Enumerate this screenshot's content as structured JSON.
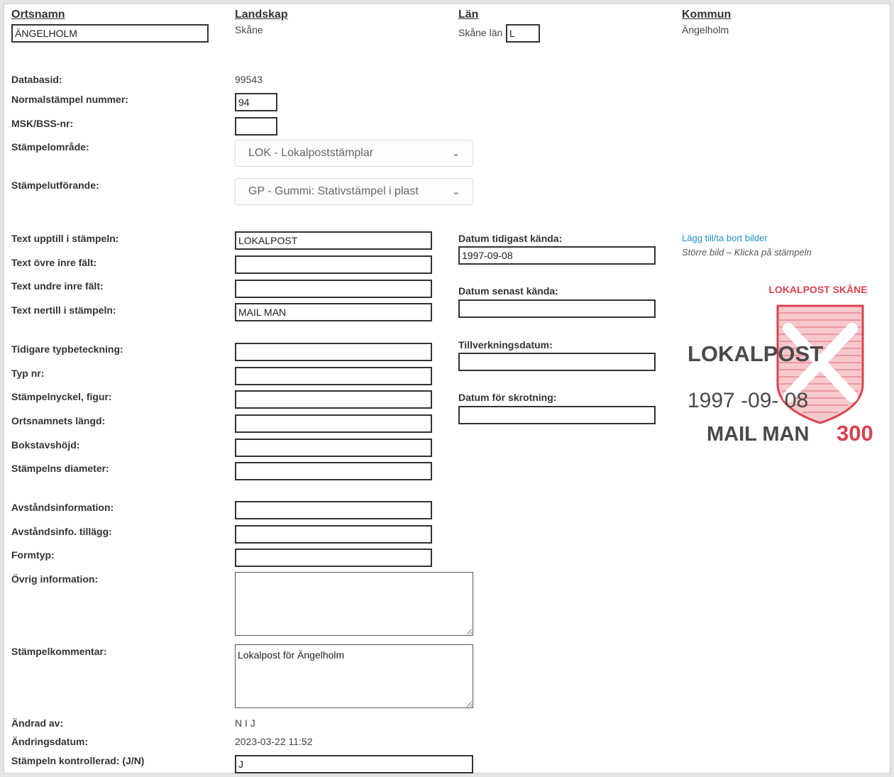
{
  "header": {
    "ortsnamn_label": "Ortsnamn",
    "ortsnamn_value": "ÄNGELHOLM",
    "landskap_label": "Landskap",
    "landskap_value": "Skåne",
    "lan_label": "Län",
    "lan_value": "Skåne län",
    "lan_code": "L",
    "kommun_label": "Kommun",
    "kommun_value": "Ängelholm"
  },
  "fields": {
    "databasid": {
      "label": "Databasid:",
      "value": "99543"
    },
    "normalstampel": {
      "label": "Normalstämpel nummer:",
      "value": "94"
    },
    "msk": {
      "label": "MSK/BSS-nr:",
      "value": ""
    },
    "stampelomrade": {
      "label": "Stämpelområde:",
      "value": "LOK - Lokalpoststämplar"
    },
    "stampelutforande": {
      "label": "Stämpelutförande:",
      "value": "GP - Gummi: Stativstämpel i plast"
    },
    "text_upptill": {
      "label": "Text upptill i stämpeln:",
      "value": "LOKALPOST"
    },
    "text_ovre": {
      "label": "Text övre inre fält:",
      "value": ""
    },
    "text_undre": {
      "label": "Text undre inre fält:",
      "value": ""
    },
    "text_nertill": {
      "label": "Text nertill i stämpeln:",
      "value": "MAIL MAN"
    },
    "tidigare_typ": {
      "label": "Tidigare typbeteckning:",
      "value": ""
    },
    "typ_nr": {
      "label": "Typ nr:",
      "value": ""
    },
    "stampelnyckel": {
      "label": "Stämpelnyckel, figur:",
      "value": ""
    },
    "ortsnamnets_langd": {
      "label": "Ortsnamnets längd:",
      "value": ""
    },
    "bokstavshojd": {
      "label": "Bokstavshöjd:",
      "value": ""
    },
    "stampelns_diameter": {
      "label": "Stämpelns diameter:",
      "value": ""
    },
    "avstandsinfo": {
      "label": "Avståndsinformation:",
      "value": ""
    },
    "avstandsinfo_tillagg": {
      "label": "Avståndsinfo. tillägg:",
      "value": ""
    },
    "formtyp": {
      "label": "Formtyp:",
      "value": ""
    },
    "ovrig_info": {
      "label": "Övrig information:",
      "value": ""
    },
    "stampelkommentar": {
      "label": "Stämpelkommentar:",
      "value": "Lokalpost för Ängelholm"
    },
    "andrad_av": {
      "label": "Ändrad av:",
      "value": "N I J"
    },
    "andringsdatum": {
      "label": "Ändringsdatum:",
      "value": "2023-03-22 11:52"
    },
    "kontrollerad": {
      "label": "Stämpeln kontrollerad: (J/N)",
      "value": "J"
    }
  },
  "dates": {
    "tidigast": {
      "label": "Datum tidigast kända:",
      "value": "1997-09-08"
    },
    "senast": {
      "label": "Datum senast kända:",
      "value": ""
    },
    "tillverkning": {
      "label": "Tillverkningsdatum:",
      "value": ""
    },
    "skrotning": {
      "label": "Datum för skrotning:",
      "value": ""
    }
  },
  "images": {
    "link_text": "Lägg till/ta bort bilder",
    "hint_text": "Större bild – Klicka på stämpeln"
  },
  "stamp": {
    "top_text": "LOKALPOST SKÅNE",
    "main_text": "LOKALPOST",
    "date_text": "1997 -09- 08",
    "bottom_text": "MAIL MAN",
    "value_text": "300",
    "ink_color": "#d9434f",
    "print_color": "#4a4a4a"
  },
  "icons": {
    "select_chevron": "chevron-down-icon",
    "coat_of_arms": "coat-of-arms-icon"
  }
}
